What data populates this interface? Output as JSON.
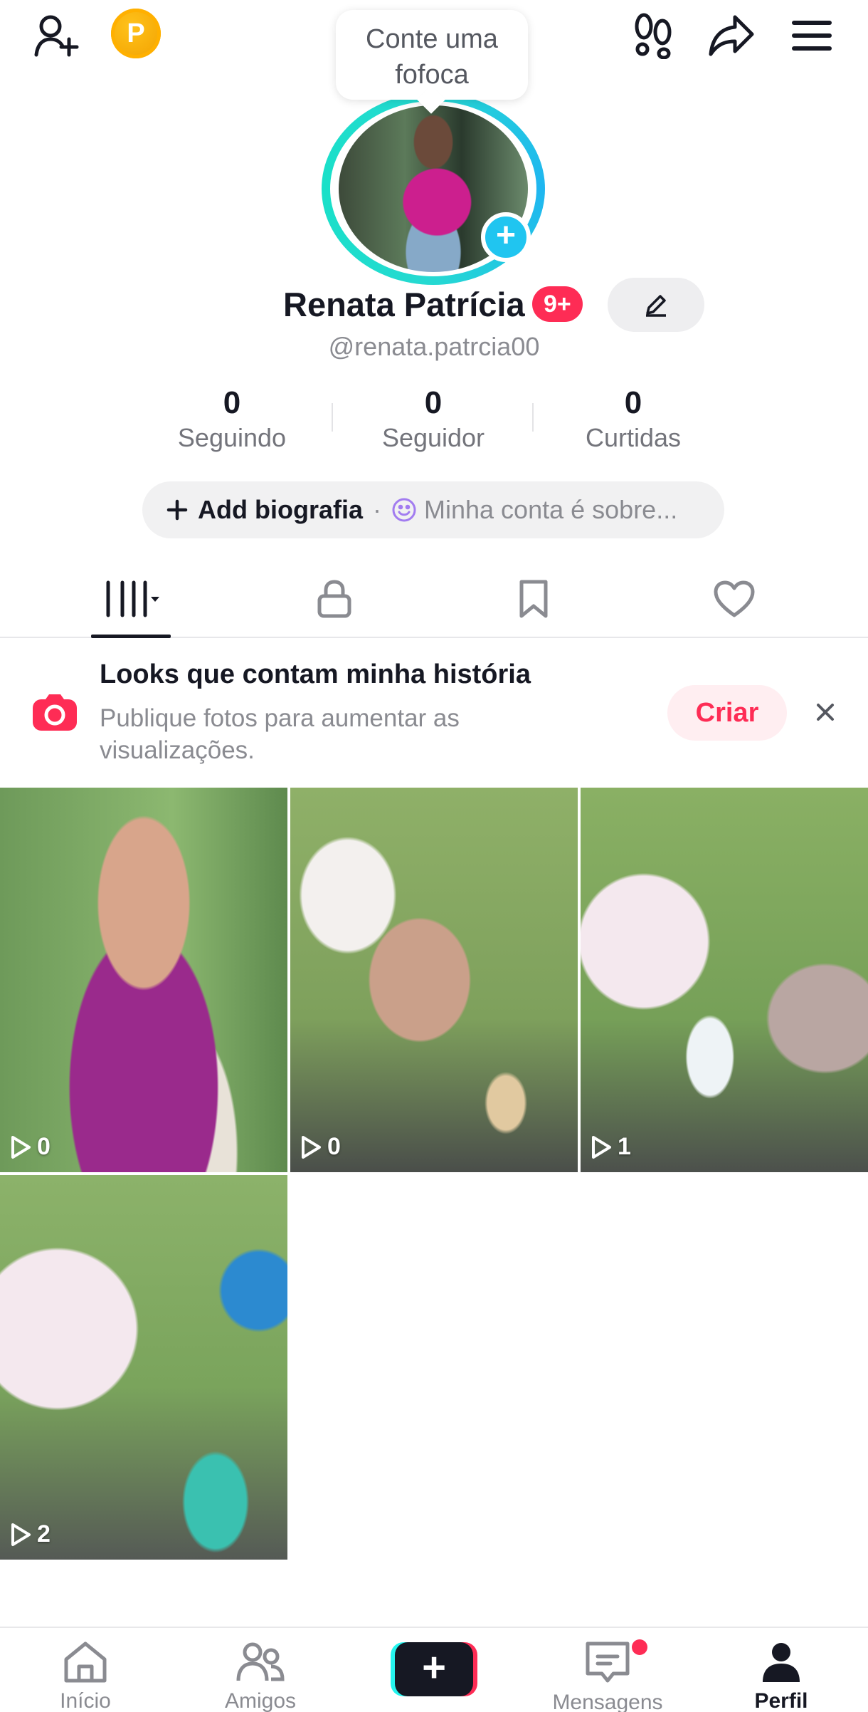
{
  "header": {
    "coin_letter": "P",
    "tooltip": "Conte uma fofoca"
  },
  "profile": {
    "name": "Renata Patrícia",
    "badge": "9+",
    "handle": "@renata.patrcia00"
  },
  "stats": [
    {
      "value": "0",
      "label": "Seguindo"
    },
    {
      "value": "0",
      "label": "Seguidor"
    },
    {
      "value": "0",
      "label": "Curtidas"
    }
  ],
  "bio": {
    "add_label": "Add biografia",
    "separator": "·",
    "placeholder": "Minha conta é sobre..."
  },
  "banner": {
    "title": "Looks que contam minha história",
    "subtitle": "Publique fotos para aumentar as visualizações.",
    "cta": "Criar"
  },
  "videos": [
    {
      "views": "0"
    },
    {
      "views": "0"
    },
    {
      "views": "1"
    },
    {
      "views": "2"
    }
  ],
  "nav": {
    "home": "Início",
    "friends": "Amigos",
    "messages": "Mensagens",
    "profile": "Perfil",
    "create": "+"
  },
  "colors": {
    "accent": "#fe2c55",
    "teal": "#25f4ee",
    "ring": "#20c5f0",
    "coin": "#f5a800"
  }
}
